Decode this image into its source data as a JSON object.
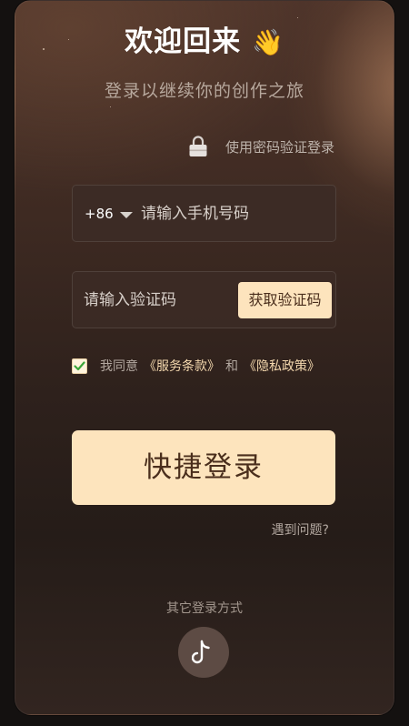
{
  "header": {
    "title": "欢迎回来",
    "title_emoji": "👋",
    "subtitle": "登录以继续你的创作之旅"
  },
  "password_login": {
    "label": "使用密码验证登录",
    "icon": "lock-icon"
  },
  "phone": {
    "country_code": "+86",
    "placeholder": "请输入手机号码"
  },
  "code": {
    "placeholder": "请输入验证码",
    "get_code_label": "获取验证码"
  },
  "agreement": {
    "checked": true,
    "prefix": "我同意",
    "terms": "《服务条款》",
    "and": "和",
    "privacy": "《隐私政策》"
  },
  "login_button": "快捷登录",
  "help_link": "遇到问题?",
  "other_methods": {
    "label": "其它登录方式",
    "icon": "tiktok-icon"
  },
  "colors": {
    "accent": "#fde4bd",
    "accent_text": "#4a2e1c",
    "link": "#f3d7ad"
  }
}
